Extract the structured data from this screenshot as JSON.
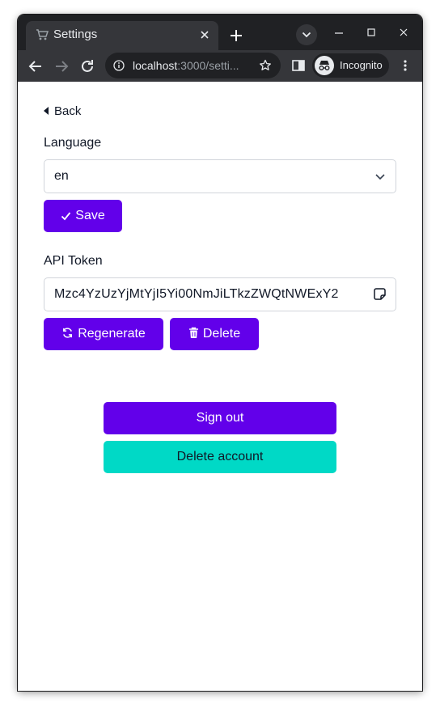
{
  "browser": {
    "tab_title": "Settings",
    "url_host": "localhost",
    "url_rest": ":3000/setti...",
    "profile_label": "Incognito"
  },
  "page": {
    "back_label": "Back",
    "language": {
      "label": "Language",
      "selected": "en"
    },
    "save_label": "Save",
    "api_token": {
      "label": "API Token",
      "value": "Mzc4YzUzYjMtYjI5Yi00NmJiLTkzZWQtNWExY2"
    },
    "regenerate_label": "Regenerate",
    "delete_label": "Delete",
    "sign_out_label": "Sign out",
    "delete_account_label": "Delete account"
  },
  "colors": {
    "primary": "#6200ea",
    "secondary": "#00d9c6",
    "browser_dark": "#202124",
    "browser_toolbar": "#35363a"
  }
}
